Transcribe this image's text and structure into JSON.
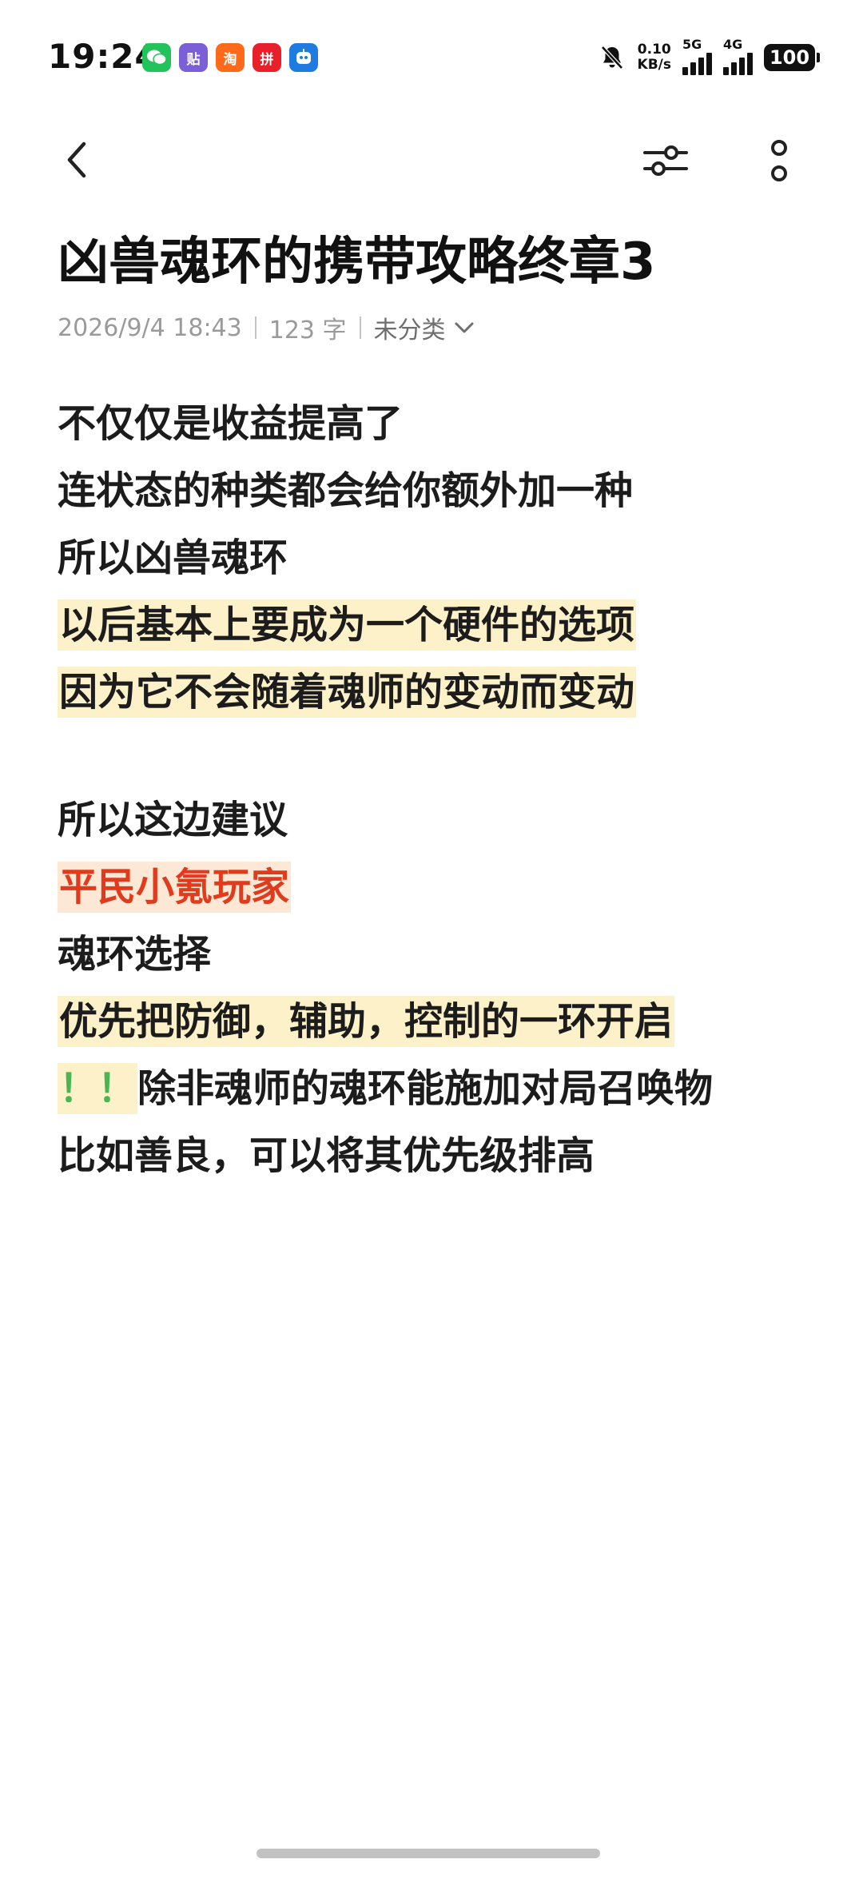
{
  "status_bar": {
    "time": "19:24",
    "apps": [
      {
        "name": "wechat-icon",
        "color": "#22c35a",
        "glyph": "✉"
      },
      {
        "name": "tieba-icon",
        "color": "#7b5fd6",
        "glyph": "贴"
      },
      {
        "name": "taobao-icon",
        "color": "#ff6a1a",
        "glyph": "淘"
      },
      {
        "name": "pinduoduo-icon",
        "color": "#e8202a",
        "glyph": "拼"
      },
      {
        "name": "robot-app-icon",
        "color": "#1f7be0",
        "glyph": "☺"
      }
    ],
    "net_speed_value": "0.10",
    "net_speed_unit": "KB/s",
    "sig1_label": "5G",
    "sig2_label": "4G",
    "battery": "100"
  },
  "note": {
    "title": "凶兽魂环的携带攻略终章3",
    "date": "2026/9/4 18:43",
    "word_count": "123 字",
    "category": "未分类",
    "lines": [
      "不仅仅是收益提高了",
      "连状态的种类都会给你额外加一种",
      "所以凶兽魂环",
      "以后基本上要成为一个硬件的选项",
      "因为它不会随着魂师的变动而变动",
      "所以这边建议",
      "平民小氪玩家",
      "魂环选择",
      "优先把防御，辅助，控制的一环开启",
      "！！",
      "除非魂师的魂环能施加对局召唤物",
      "比如善良，可以将其优先级排高"
    ]
  },
  "colors": {
    "highlight_yellow": "#fdf1c9",
    "highlight_red_bg": "#fde8d6",
    "red_text": "#e03b1d",
    "green_text": "#4ab552"
  }
}
